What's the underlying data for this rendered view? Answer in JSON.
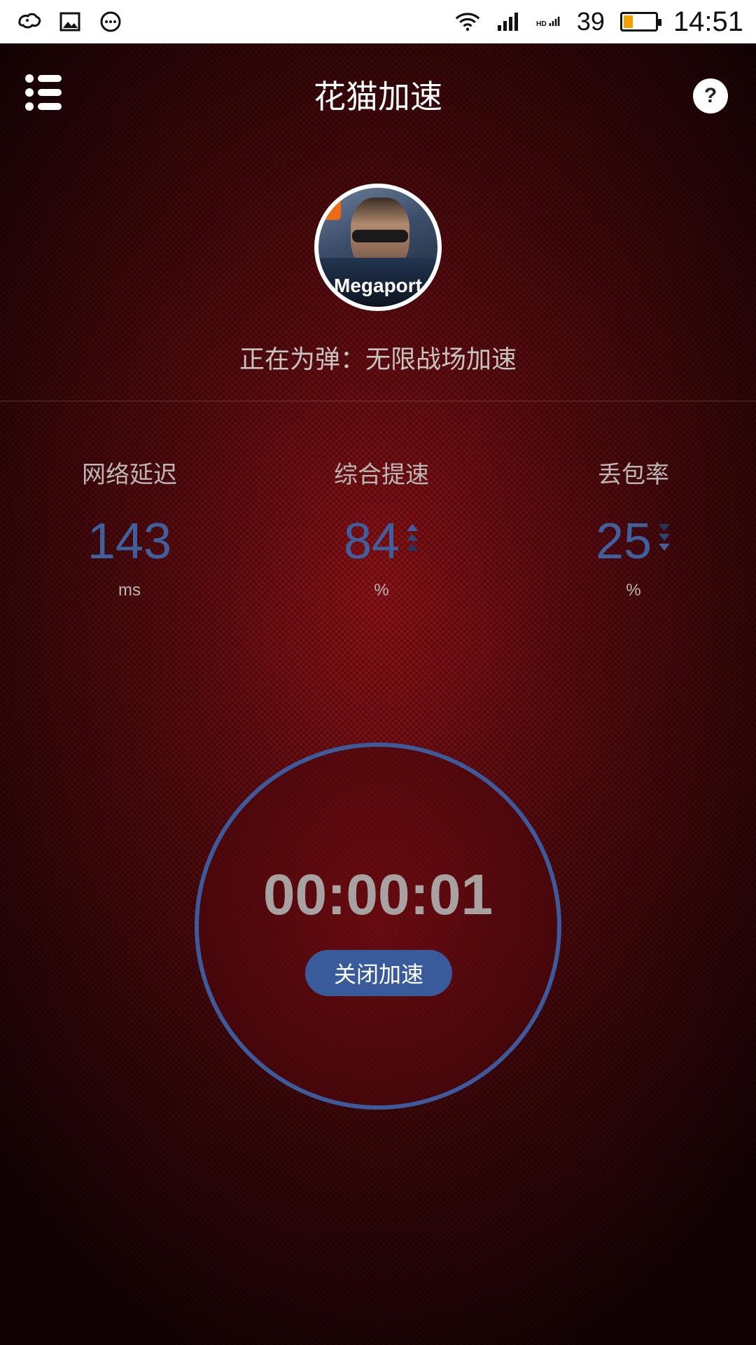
{
  "status_bar": {
    "signal_level": "39",
    "time": "14:51",
    "battery_level": 0.3
  },
  "header": {
    "title": "花猫加速",
    "help_label": "?"
  },
  "game": {
    "avatar_label": "Megaport",
    "accelerating_text": "正在为弹：无限战场加速"
  },
  "stats": [
    {
      "label": "网络延迟",
      "value": "143",
      "unit": "ms"
    },
    {
      "label": "综合提速",
      "value": "84",
      "unit": "%"
    },
    {
      "label": "丢包率",
      "value": "25",
      "unit": "%"
    }
  ],
  "timer": {
    "elapsed": "00:00:01",
    "stop_label": "关闭加速"
  },
  "colors": {
    "accent_blue": "#3d5a9c",
    "background_red": "#8c1016"
  }
}
